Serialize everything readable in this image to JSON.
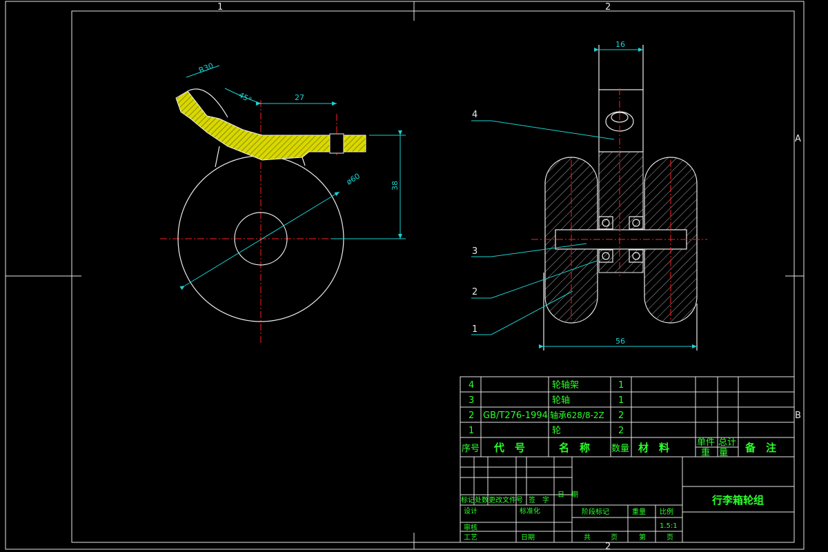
{
  "colors": {
    "background": "#000000",
    "frame": "#e8e8e8",
    "dimension": "#19d3d3",
    "centerline": "#ff2020",
    "text": "#2bff2b",
    "hatch_fill": "#e6e600"
  },
  "zones": {
    "top_1": "1",
    "top_2": "2",
    "bottom_2": "2",
    "right_a": "A",
    "right_b": "B"
  },
  "dims": {
    "r30": "R30",
    "angle45": "45°",
    "d27": "27",
    "d38": "38",
    "dia60": "ø60",
    "d16": "16",
    "d56": "56"
  },
  "balloons": {
    "b4": "4",
    "b3": "3",
    "b2": "2",
    "b1": "1"
  },
  "bom": {
    "rows": [
      {
        "no": "4",
        "code": "",
        "name": "轮轴架",
        "qty": "1"
      },
      {
        "no": "3",
        "code": "",
        "name": "轮轴",
        "qty": "1"
      },
      {
        "no": "2",
        "code": "GB/T276-1994",
        "name": "轴承628/8-2Z",
        "qty": "2"
      },
      {
        "no": "1",
        "code": "",
        "name": "轮",
        "qty": "2"
      }
    ],
    "header": {
      "no": "序号",
      "code": "代　号",
      "name": "名　称",
      "qty": "数量",
      "material": "材　料",
      "unit_weight": "单件",
      "total_weight": "总计",
      "weight": "重　量",
      "remark": "备　注"
    }
  },
  "titleblock": {
    "title": "行李箱轮组",
    "mark": "标记",
    "count": "处数",
    "change_doc": "更改文件号",
    "sign": "签　字",
    "date_v": "日　期",
    "design": "设计",
    "standard": "标准化",
    "review": "审核",
    "process": "工艺",
    "date": "日期",
    "stage_mark": "阶段标记",
    "weight": "重量",
    "scale_label": "比例",
    "scale": "1.5:1",
    "total": "共",
    "sheet": "页",
    "of": "第",
    "page": "页"
  }
}
